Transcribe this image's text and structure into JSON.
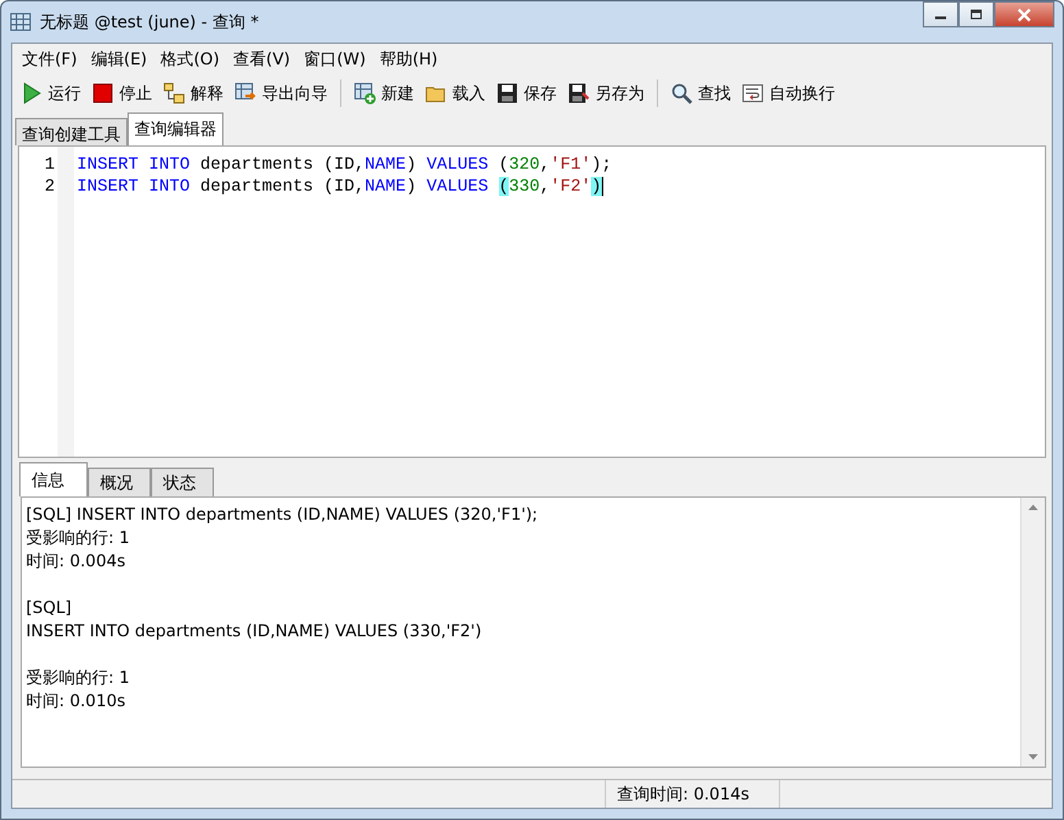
{
  "window": {
    "title": "无标题 @test (june) - 查询 *"
  },
  "menu": [
    "文件(F)",
    "编辑(E)",
    "格式(O)",
    "查看(V)",
    "窗口(W)",
    "帮助(H)"
  ],
  "toolbar": [
    {
      "kind": "run",
      "label": "运行"
    },
    {
      "kind": "stop",
      "label": "停止"
    },
    {
      "kind": "explain",
      "label": "解释"
    },
    {
      "kind": "export",
      "label": "导出向导"
    },
    {
      "kind": "separator"
    },
    {
      "kind": "new",
      "label": "新建"
    },
    {
      "kind": "load",
      "label": "载入"
    },
    {
      "kind": "save",
      "label": "保存"
    },
    {
      "kind": "saveas",
      "label": "另存为"
    },
    {
      "kind": "separator"
    },
    {
      "kind": "find",
      "label": "查找"
    },
    {
      "kind": "wrap",
      "label": "自动换行"
    }
  ],
  "tabs": [
    {
      "label": "查询创建工具",
      "selected": false
    },
    {
      "label": "查询编辑器",
      "selected": true
    }
  ],
  "editor": {
    "lines": [
      {
        "number": "1",
        "tokens": [
          {
            "text": "INSERT INTO",
            "kind": "keyword"
          },
          {
            "text": " departments (ID,",
            "kind": "plain"
          },
          {
            "text": "NAME",
            "kind": "keyword"
          },
          {
            "text": ") ",
            "kind": "plain"
          },
          {
            "text": "VALUES",
            "kind": "keyword"
          },
          {
            "text": " (",
            "kind": "plain"
          },
          {
            "text": "320",
            "kind": "number"
          },
          {
            "text": ",",
            "kind": "plain"
          },
          {
            "text": "'F1'",
            "kind": "string"
          },
          {
            "text": ");",
            "kind": "plain"
          }
        ],
        "cursor": false
      },
      {
        "number": "2",
        "tokens": [
          {
            "text": "INSERT INTO",
            "kind": "keyword"
          },
          {
            "text": " departments (ID,",
            "kind": "plain"
          },
          {
            "text": "NAME",
            "kind": "keyword"
          },
          {
            "text": ") ",
            "kind": "plain"
          },
          {
            "text": "VALUES ",
            "kind": "keyword"
          },
          {
            "text": "(",
            "kind": "plain",
            "matched": true
          },
          {
            "text": "330",
            "kind": "number"
          },
          {
            "text": ",",
            "kind": "plain"
          },
          {
            "text": "'F2'",
            "kind": "string"
          },
          {
            "text": ")",
            "kind": "plain",
            "matched": true
          }
        ],
        "cursor": true
      }
    ]
  },
  "result_tabs": [
    {
      "label": "信息",
      "selected": true
    },
    {
      "label": "概况",
      "selected": false
    },
    {
      "label": "状态",
      "selected": false
    }
  ],
  "messages": [
    {
      "lines": [
        "[SQL] INSERT INTO departments (ID,NAME) VALUES (320,'F1');",
        "受影响的行: 1",
        "时间: 0.004s"
      ]
    },
    {
      "lines": [
        "[SQL]",
        "INSERT INTO departments (ID,NAME) VALUES (330,'F2')"
      ]
    },
    {
      "lines": [
        "受影响的行: 1",
        "时间: 0.010s"
      ]
    }
  ],
  "status_bar": {
    "query_time": "查询时间: 0.014s"
  }
}
